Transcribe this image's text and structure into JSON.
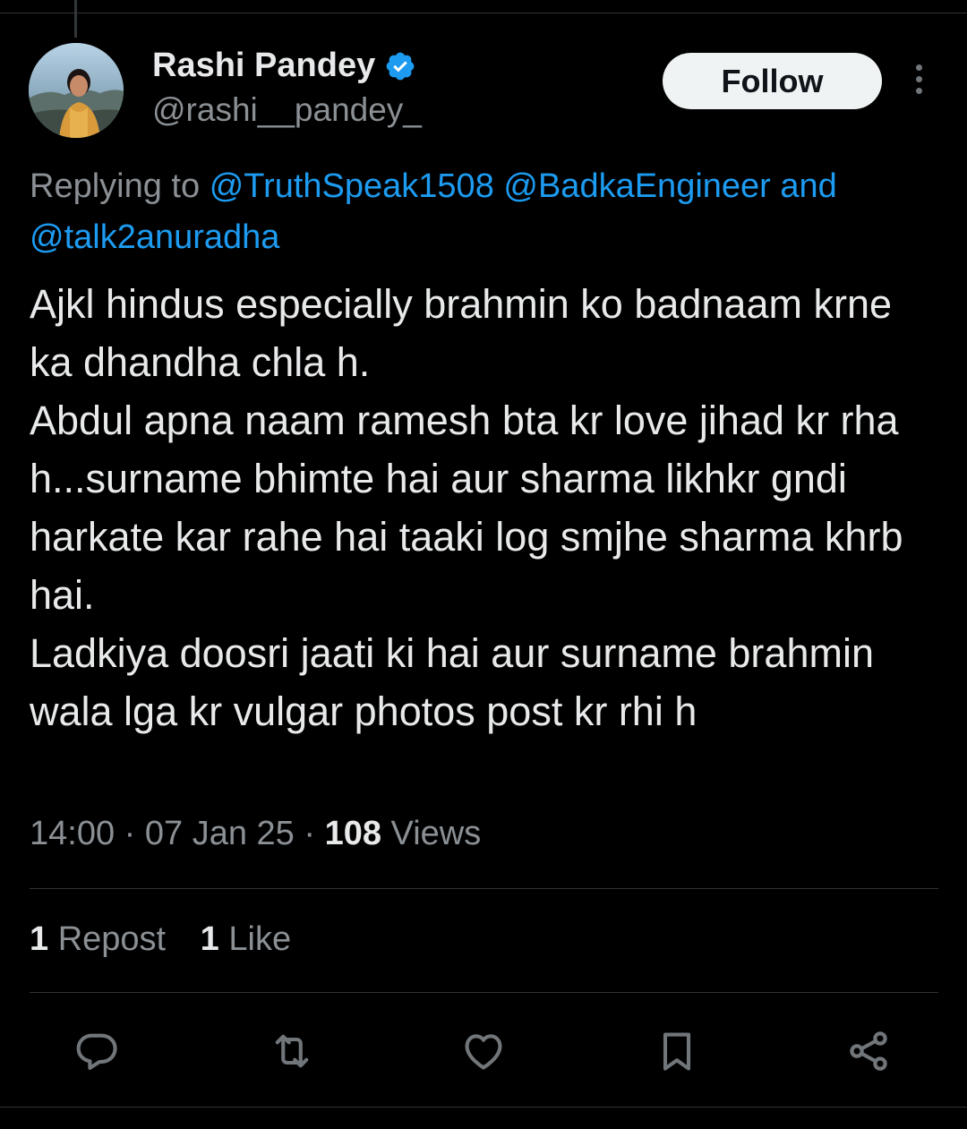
{
  "author": {
    "display_name": "Rashi Pandey",
    "handle": "@rashi__pandey_",
    "verified": true
  },
  "header": {
    "follow_label": "Follow",
    "more_icon": "more-vertical-icon"
  },
  "reply": {
    "prefix": "Replying to",
    "mentions": [
      "@TruthSpeak1508",
      "@BadkaEngineer",
      "@talk2anuradha"
    ],
    "joiner": "and"
  },
  "tweet": {
    "text": "Ajkl hindus especially brahmin ko badnaam krne ka dhandha chla h.\nAbdul apna naam ramesh bta kr love jihad kr rha h...surname bhimte hai aur sharma likhkr gndi harkate kar rahe hai taaki log smjhe sharma khrb hai.\nLadkiya doosri jaati ki hai aur surname brahmin wala lga kr vulgar photos post kr rhi h",
    "time": "14:00",
    "date": "07 Jan 25",
    "separator": "·",
    "views_count": "108",
    "views_label": "Views"
  },
  "stats": {
    "reposts_count": "1",
    "reposts_label": "Repost",
    "likes_count": "1",
    "likes_label": "Like"
  },
  "actions": [
    "reply-icon",
    "repost-icon",
    "like-icon",
    "bookmark-icon",
    "share-icon"
  ],
  "colors": {
    "background": "#000000",
    "text": "#e7e9ea",
    "muted": "#8b9095",
    "accent": "#1d9bf0",
    "follow_bg": "#eff3f4"
  }
}
